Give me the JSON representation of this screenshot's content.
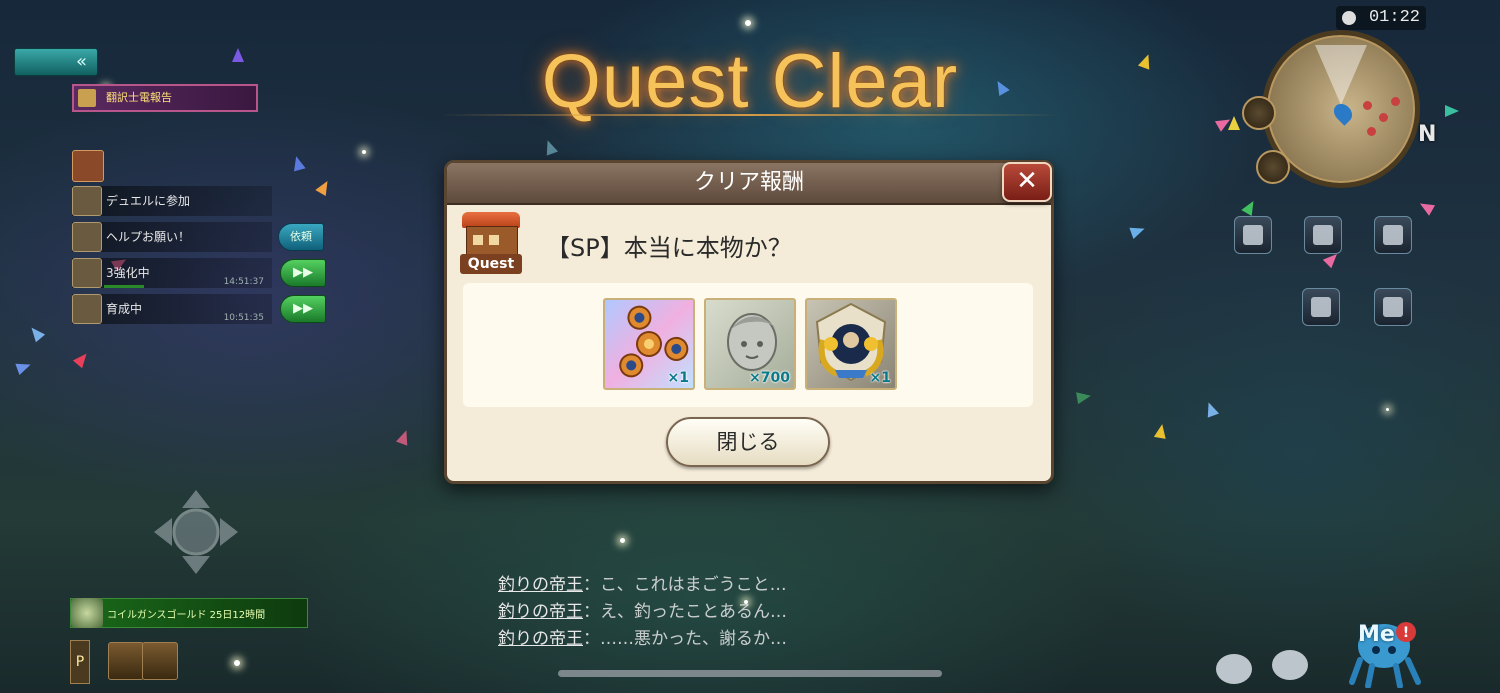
{
  "title": "Quest Clear",
  "timer": "01:22",
  "compass": "N",
  "left_panel": {
    "mission_header": "翻訳士電報告",
    "tasks": [
      {
        "label": "デュエルに参加",
        "time": "",
        "action": ""
      },
      {
        "label": "ヘルプお願い！",
        "time": "",
        "action": "依頼"
      },
      {
        "label": "3強化中",
        "time": "14:51:37",
        "action": "▶▶"
      },
      {
        "label": "育成中",
        "time": "10:51:35",
        "action": "▶▶"
      }
    ]
  },
  "bottom_bar": {
    "text": "コイルガンスゴールド   25日12時間"
  },
  "p_label": "P",
  "chat": [
    {
      "who": "釣りの帝王",
      "msg": "こ、これはまごうこと…"
    },
    {
      "who": "釣りの帝王",
      "msg": "え、釣ったことあるん…"
    },
    {
      "who": "釣りの帝王",
      "msg": "……悪かった、謝るか…"
    }
  ],
  "dialog": {
    "header": "クリア報酬",
    "quest_icon_label": "Quest",
    "quest_name": "【SP】本当に本物か？",
    "rewards": [
      {
        "icon": "orange-spinner-icon",
        "count": "×1"
      },
      {
        "icon": "silver-head-medal-icon",
        "count": "×700"
      },
      {
        "icon": "gold-emblem-icon",
        "count": "×1"
      }
    ],
    "close_label": "閉じる"
  },
  "me_label": "Me",
  "colors": {
    "title": "#f6c35a",
    "dialog_bg": "#f4ecd8",
    "header_bg": "#6e5a4a",
    "close_red": "#b84a3a"
  }
}
